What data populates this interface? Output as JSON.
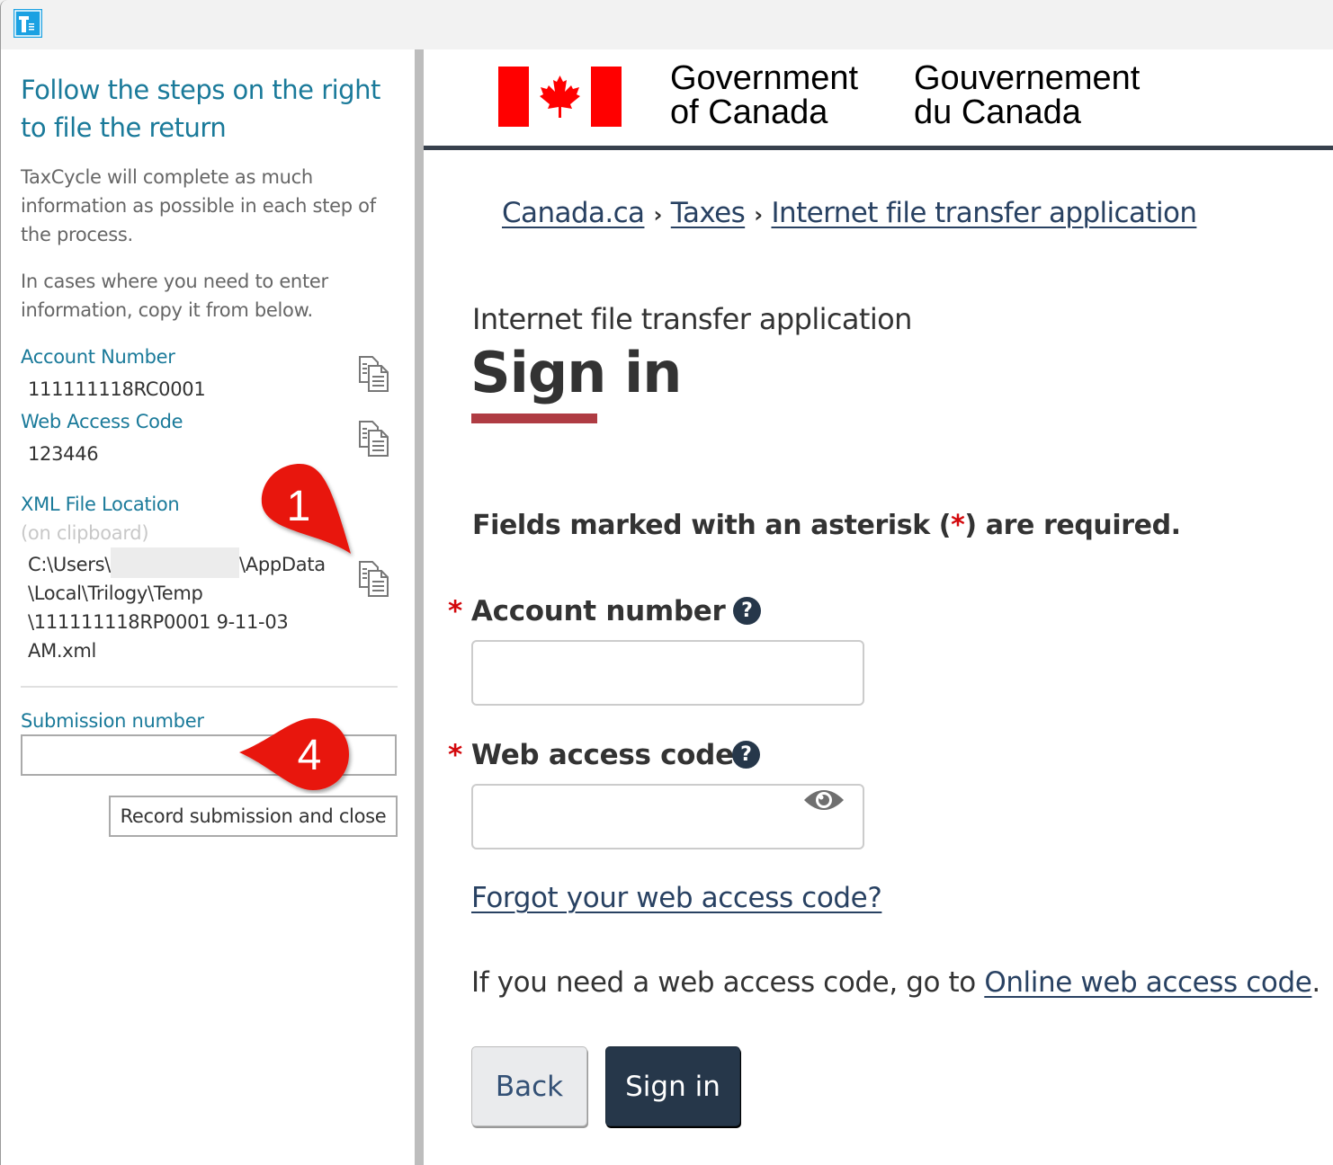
{
  "window": {
    "app_icon": "taxcycle-app-icon"
  },
  "left_panel": {
    "heading": "Follow the steps on the right to file the return",
    "intro_paragraph": "TaxCycle will complete as much information as possible in each step of the process.",
    "copy_paragraph": "In cases where you need to enter information, copy it from below.",
    "fields": {
      "account_number": {
        "label": "Account Number",
        "value": "111111118RC0001",
        "icon": "copy-icon"
      },
      "web_access_code": {
        "label": "Web Access Code",
        "value": "123446",
        "icon": "copy-icon"
      },
      "xml_file_location": {
        "label": "XML File Location",
        "note": "(on clipboard)",
        "value_line1_start": "C:\\Users\\",
        "value_line1_end": "\\AppData",
        "value_line2": "\\Local\\Trilogy\\Temp",
        "value_line3": "\\111111118RP0001 9-11-03",
        "value_line4": "AM.xml",
        "icon": "copy-icon"
      }
    },
    "submission": {
      "label": "Submission number",
      "value": "",
      "placeholder": ""
    },
    "record_button": "Record submission and close"
  },
  "callouts": [
    {
      "number": "1",
      "color": "#e8150d"
    },
    {
      "number": "4",
      "color": "#e8150d"
    }
  ],
  "web_page": {
    "header": {
      "government_en_line1": "Government",
      "government_en_line2": "of Canada",
      "government_fr_line1": "Gouvernement",
      "government_fr_line2": "du Canada",
      "flag_color": "#ff0000",
      "rule_color": "#38414d"
    },
    "breadcrumb": [
      {
        "label": "Canada.ca"
      },
      {
        "label": "Taxes"
      },
      {
        "label": "Internet file transfer application"
      }
    ],
    "breadcrumb_separator": "›",
    "subtitle": "Internet file transfer application",
    "title": "Sign in",
    "title_accent_color": "#af3c43",
    "required_note_before": "Fields marked with an asterisk (",
    "required_note_asterisk": "*",
    "required_note_after": ") are required.",
    "form": {
      "account_number": {
        "label": "Account number",
        "asterisk": "*",
        "value": "",
        "help_icon": "?"
      },
      "web_access_code": {
        "label": "Web access code",
        "asterisk": "*",
        "value": "",
        "help_icon": "?",
        "toggle_icon": "eye-icon"
      }
    },
    "forgot_link": "Forgot your web access code?",
    "info_text": "If you need a web access code, go to ",
    "info_link": "Online web access code",
    "info_text_end": ".",
    "buttons": {
      "back": "Back",
      "sign_in": "Sign in"
    },
    "colors": {
      "link": "#284162",
      "primary_button": "#26374a",
      "asterisk": "#d3080c"
    }
  }
}
